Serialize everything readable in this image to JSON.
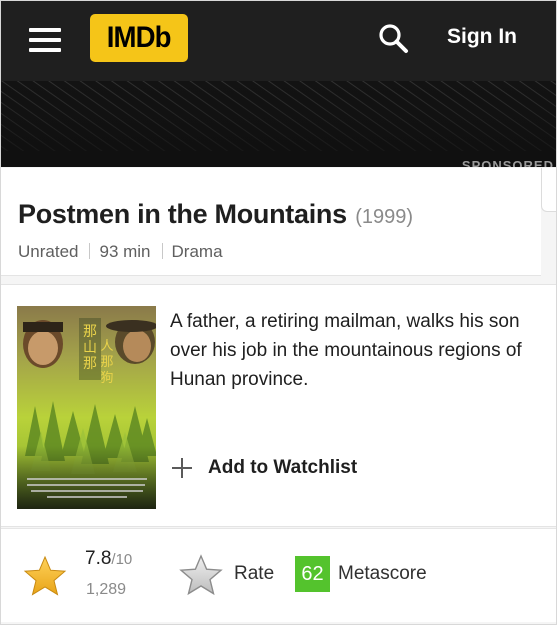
{
  "header": {
    "logo_text": "IMDb",
    "menu_icon": "hamburger-menu-icon",
    "search_icon": "search-icon",
    "signin_label": "Sign In",
    "logo_color": "#f5c518",
    "bar_color": "#1f1f1f"
  },
  "ad": {
    "sponsored_label": "SPONSORED"
  },
  "title": {
    "name": "Postmen in the Mountains",
    "year": "(1999)",
    "certificate": "Unrated",
    "runtime": "93 min",
    "genre": "Drama"
  },
  "overview": {
    "poster_icon": "movie-poster-image",
    "plot": "A father, a retiring mailman, walks his son over his job in the mountainous regions of Hunan province.",
    "watchlist_label": "Add to Watchlist",
    "watchlist_icon": "plus-icon"
  },
  "ratings": {
    "star_icon": "star-icon",
    "rating_value": "7.8",
    "rating_out_of": "/10",
    "vote_count": "1,289",
    "rate_icon": "star-outline-icon",
    "rate_label": "Rate",
    "metascore_value": "62",
    "metascore_label": "Metascore",
    "metascore_color": "#54c32d"
  }
}
